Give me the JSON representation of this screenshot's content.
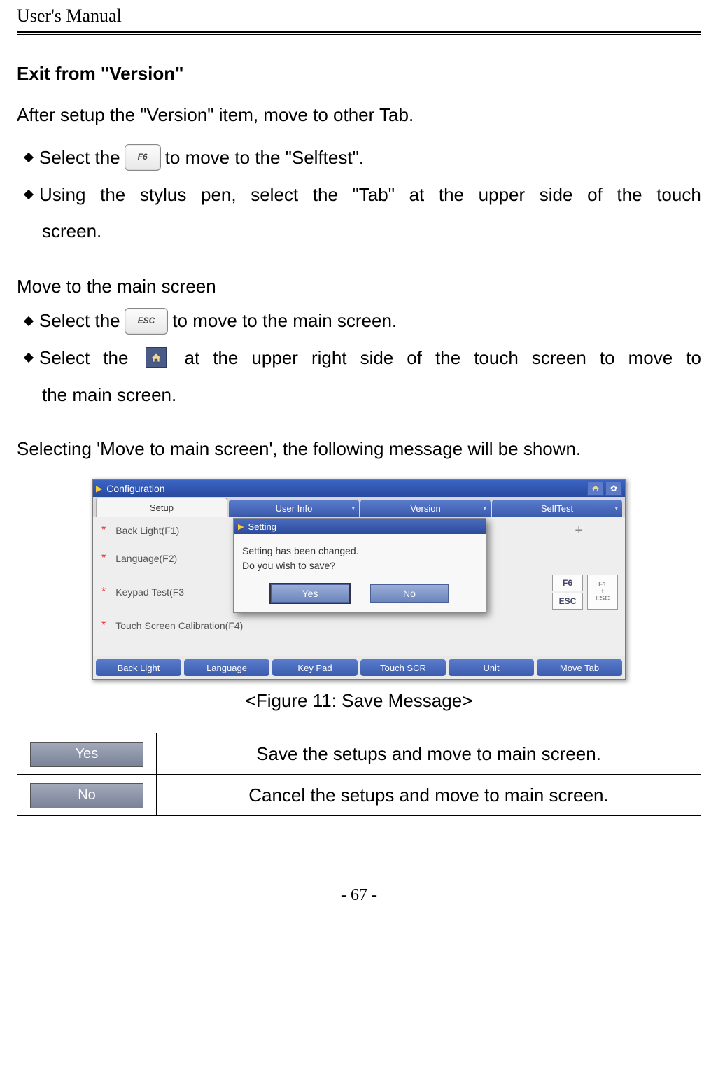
{
  "header": "User's Manual",
  "section1": {
    "title": "Exit from \"Version\"",
    "intro": "After setup the \"Version\" item, move to other Tab.",
    "bullets": [
      {
        "pre": "Select the",
        "key": "F6",
        "post": "to move to the \"Selftest\"."
      },
      {
        "full_justified": [
          "Using",
          "the",
          "stylus",
          "pen,",
          "select",
          "the",
          "\"Tab\"",
          "at",
          "the",
          "upper",
          "side",
          "of",
          "the",
          "touch"
        ],
        "cont": "screen."
      }
    ]
  },
  "section2": {
    "title": "Move to the main screen",
    "bullets": [
      {
        "pre": "Select the",
        "key": "ESC",
        "post": "to move to the main screen."
      },
      {
        "pre_words": [
          "Select",
          "the"
        ],
        "icon": "home-icon",
        "post_words": [
          "at",
          "the",
          "upper",
          "right",
          "side",
          "of",
          "the",
          "touch",
          "screen",
          "to",
          "move",
          "to"
        ],
        "cont": "the main screen."
      }
    ]
  },
  "transition": "Selecting 'Move to main screen', the following message will be shown.",
  "screenshot": {
    "window_title": "Configuration",
    "tabs": [
      "Setup",
      "User Info",
      "Version",
      "SelfTest"
    ],
    "active_tab_index": 0,
    "rows": [
      {
        "label": "Back Light(F1)"
      },
      {
        "label": "Language(F2)"
      },
      {
        "label": "Keypad Test(F3",
        "keys": [
          "F6",
          "F1+ESC",
          "ESC"
        ]
      },
      {
        "label": "Touch Screen Calibration(F4)"
      }
    ],
    "plus": "+",
    "dialog": {
      "title": "Setting",
      "line1": "Setting has been changed.",
      "line2": "Do you wish to save?",
      "yes": "Yes",
      "no": "No"
    },
    "bottom_buttons": [
      "Back Light",
      "Language",
      "Key Pad",
      "Touch SCR",
      "Unit",
      "Move Tab"
    ]
  },
  "caption": "<Figure 11: Save Message>",
  "table": {
    "yes": {
      "btn": "Yes",
      "desc": "Save the setups and move to main screen."
    },
    "no": {
      "btn": "No",
      "desc": "Cancel the setups and move to main screen."
    }
  },
  "page_number": "- 67 -"
}
